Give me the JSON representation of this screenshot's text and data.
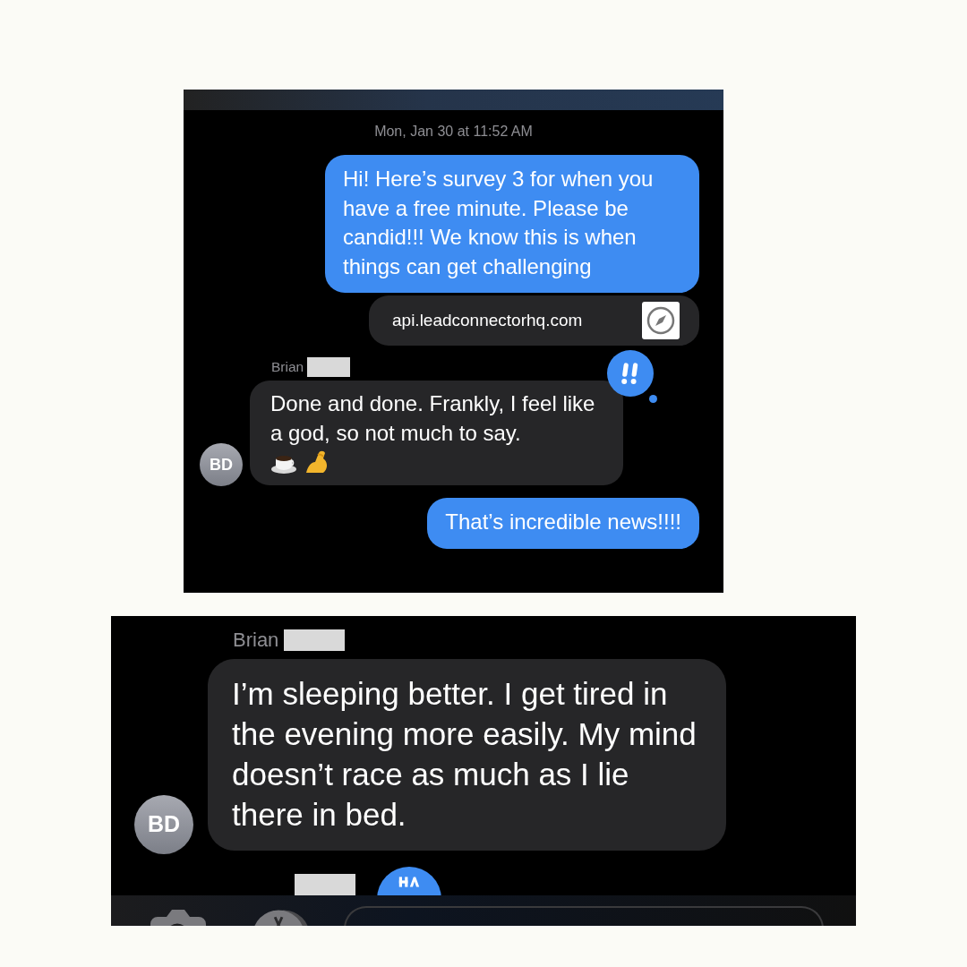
{
  "panels": [
    {
      "kind": "chat",
      "header": {
        "kind": "gradient"
      },
      "timestamp": "Mon, Jan 30 at 11:52 AM",
      "messages": [
        {
          "kind": "outgoing",
          "text": "Hi! Here’s survey 3 for when you have a free minute. Please be candid!!! We know this is when things can get challenging"
        },
        {
          "kind": "link",
          "text": "api.leadconnectorhq.com"
        },
        {
          "kind": "incoming",
          "sender": "Brian",
          "avatar": "BD",
          "text": "Done and done. Frankly, I feel like a god, so not much to say.",
          "emoji": [
            {
              "kind": "coffee"
            },
            {
              "kind": "flexed-biceps"
            }
          ],
          "reaction": {
            "kind": "emphasis"
          }
        },
        {
          "kind": "outgoing",
          "text": "That’s incredible news!!!!"
        }
      ]
    },
    {
      "kind": "chat-large",
      "messages": [
        {
          "kind": "incoming",
          "sender": "Brian",
          "avatar": "BD",
          "text": "I’m sleeping better. I get tired in the evening more easily. My mind doesn’t race as much as I lie there in bed."
        },
        {
          "kind": "cut",
          "reaction": {
            "kind": "haha"
          }
        }
      ],
      "composer": {
        "kind": "imessage"
      }
    }
  ]
}
